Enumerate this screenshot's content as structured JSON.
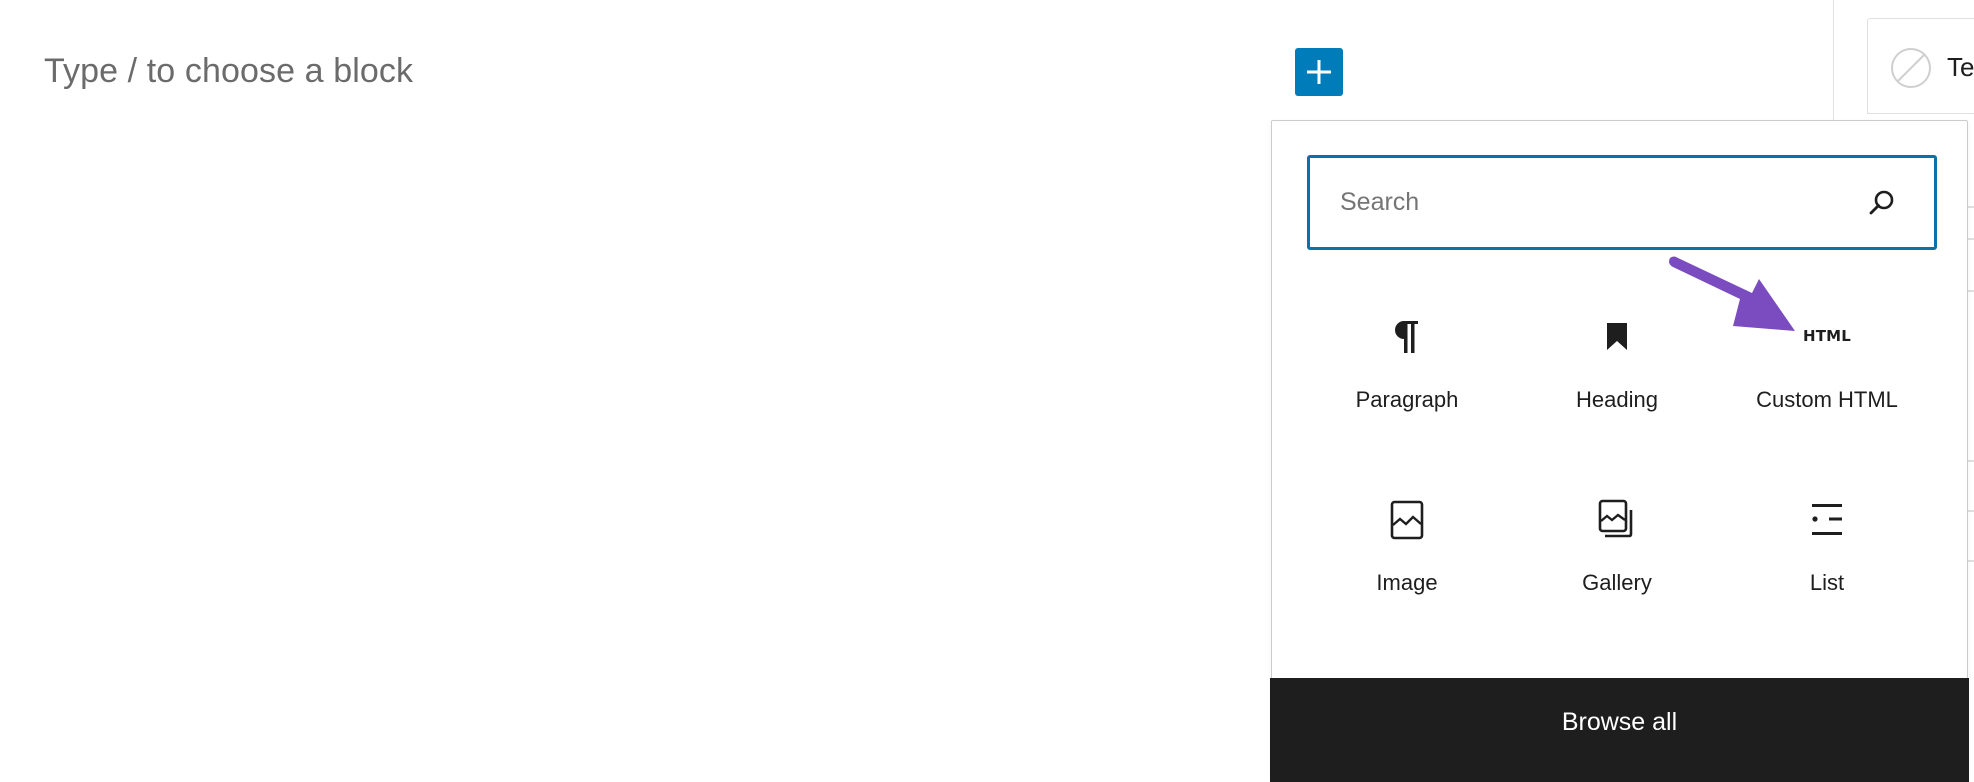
{
  "editor": {
    "block_placeholder": "Type / to choose a block",
    "inserter_toggle_icon": "plus-icon",
    "accent_color": "#007cba"
  },
  "inserter": {
    "search": {
      "placeholder": "Search",
      "value": "",
      "icon": "search-icon"
    },
    "blocks": [
      {
        "label": "Paragraph",
        "icon": "paragraph-icon"
      },
      {
        "label": "Heading",
        "icon": "heading-bookmark-icon"
      },
      {
        "label": "Custom HTML",
        "icon": "html-icon",
        "icon_text": "HTML"
      },
      {
        "label": "Image",
        "icon": "image-icon"
      },
      {
        "label": "Gallery",
        "icon": "gallery-icon"
      },
      {
        "label": "List",
        "icon": "list-icon"
      }
    ],
    "browse_all_label": "Browse all"
  },
  "sidebar": {
    "card_label_fragment": "Te",
    "card_icon": "no-entry-icon"
  },
  "annotation": {
    "type": "arrow",
    "color": "#7b4bc0",
    "points_to": "Custom HTML"
  }
}
